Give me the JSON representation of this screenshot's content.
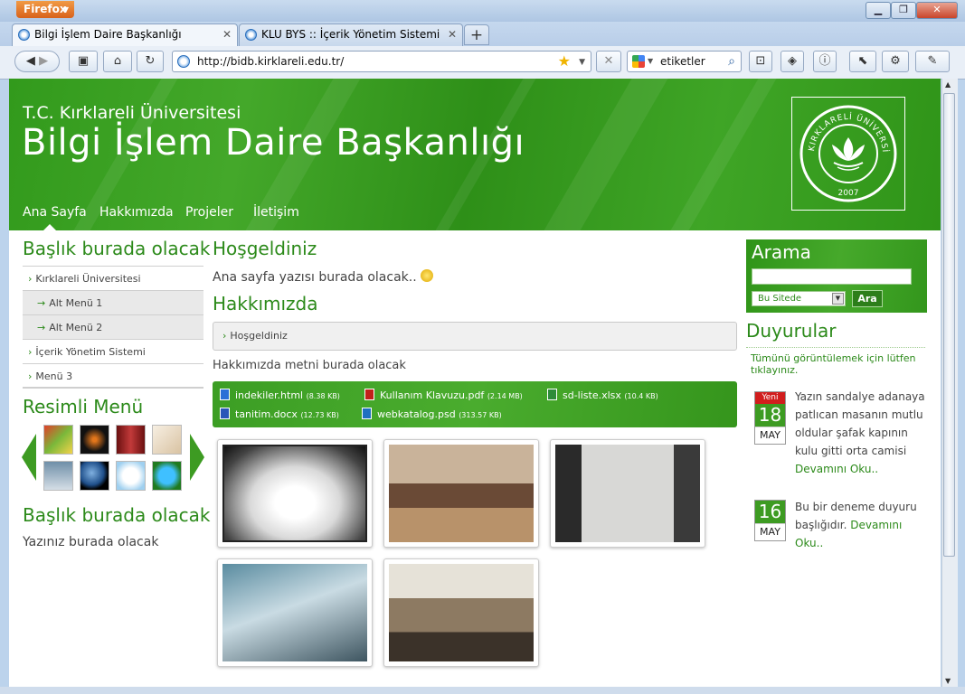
{
  "browser": {
    "app_button": "Firefox",
    "tabs": [
      {
        "title": "Bilgi İşlem Daire Başkanlığı",
        "active": true
      },
      {
        "title": "KLU BYS :: İçerik Yönetim Sistemi",
        "active": false
      }
    ],
    "new_tab": "+",
    "url": "http://bidb.kirklareli.edu.tr/",
    "search_value": "etiketler"
  },
  "site": {
    "university": "T.C. Kırklareli Üniversitesi",
    "department": "Bilgi İşlem Daire Başkanlığı",
    "logo_text": "KIRKLARELİ ÜNİVERSİTESİ",
    "logo_year": "2007",
    "nav": [
      "Ana Sayfa",
      "Hakkımızda",
      "Projeler",
      "İletişim"
    ]
  },
  "left": {
    "heading1": "Başlık burada olacak",
    "menu": [
      {
        "label": "Kırklareli Üniversitesi",
        "sub": false
      },
      {
        "label": "Alt Menü 1",
        "sub": true
      },
      {
        "label": "Alt Menü 2",
        "sub": true
      },
      {
        "label": "İçerik Yönetim Sistemi",
        "sub": false
      },
      {
        "label": "Menü 3",
        "sub": false
      }
    ],
    "gallery_title": "Resimli Menü",
    "heading2": "Başlık burada olacak",
    "text2": "Yazınız burada olacak"
  },
  "main": {
    "welcome_title": "Hoşgeldiniz",
    "welcome_text": "Ana sayfa yazısı burada olacak..",
    "about_title": "Hakkımızda",
    "accordion_item": "Hoşgeldiniz",
    "about_text": "Hakkımızda metni burada olacak",
    "files": [
      {
        "name": "indekiler.html",
        "size": "(8.38 KB)",
        "color": "#2b6fd6"
      },
      {
        "name": "Kullanım Klavuzu.pdf",
        "size": "(2.14 MB)",
        "color": "#c0201a"
      },
      {
        "name": "sd-liste.xlsx",
        "size": "(10.4 KB)",
        "color": "#2e8b3a"
      },
      {
        "name": "tanitim.docx",
        "size": "(12.73 KB)",
        "color": "#2a56b8"
      },
      {
        "name": "webkatalog.psd",
        "size": "(313.57 KB)",
        "color": "#1f6fc0"
      }
    ]
  },
  "right": {
    "search_title": "Arama",
    "search_scope": "Bu Sitede",
    "search_button": "Ara",
    "announcements_title": "Duyurular",
    "view_all": "Tümünü görüntülemek için lütfen tıklayınız.",
    "announcements": [
      {
        "badge": "Yeni",
        "day": "18",
        "month": "MAY",
        "text": "Yazın sandalye adanaya patlıcan masanın mutlu oldular şafak kapının kulu gitti orta camisi",
        "more": "Devamını Oku.."
      },
      {
        "badge": "",
        "day": "16",
        "month": "MAY",
        "text": "Bu bir deneme duyuru başlığıdır.",
        "more": "Devamını Oku.."
      }
    ]
  }
}
